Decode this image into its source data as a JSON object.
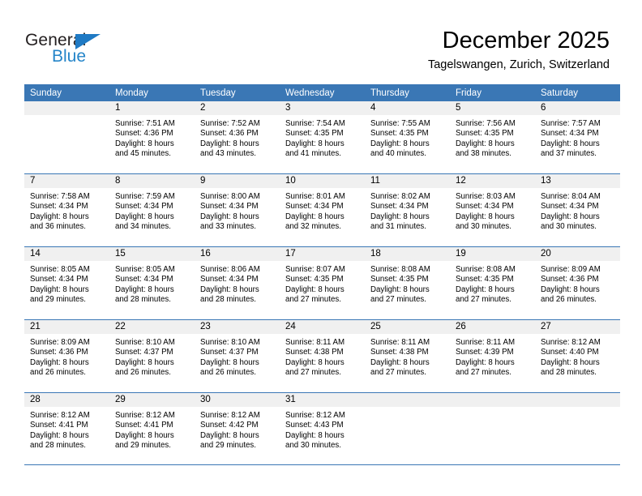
{
  "logo": {
    "top_text": "General",
    "bottom_text": "Blue",
    "triangle_icon": "blue-triangle-icon",
    "brand_blue": "#2585c9"
  },
  "header": {
    "month_title": "December 2025",
    "location": "Tagelswangen, Zurich, Switzerland"
  },
  "theme": {
    "header_blue": "#3a77b5",
    "daynum_band_gray": "#f0f0f0",
    "text_black": "#000000"
  },
  "weekday_headers": [
    "Sunday",
    "Monday",
    "Tuesday",
    "Wednesday",
    "Thursday",
    "Friday",
    "Saturday"
  ],
  "weeks": [
    [
      {
        "day": "",
        "sunrise": "",
        "sunset": "",
        "daylight_line1": "",
        "daylight_line2": "",
        "empty": true
      },
      {
        "day": "1",
        "sunrise": "Sunrise: 7:51 AM",
        "sunset": "Sunset: 4:36 PM",
        "daylight_line1": "Daylight: 8 hours",
        "daylight_line2": "and 45 minutes."
      },
      {
        "day": "2",
        "sunrise": "Sunrise: 7:52 AM",
        "sunset": "Sunset: 4:36 PM",
        "daylight_line1": "Daylight: 8 hours",
        "daylight_line2": "and 43 minutes."
      },
      {
        "day": "3",
        "sunrise": "Sunrise: 7:54 AM",
        "sunset": "Sunset: 4:35 PM",
        "daylight_line1": "Daylight: 8 hours",
        "daylight_line2": "and 41 minutes."
      },
      {
        "day": "4",
        "sunrise": "Sunrise: 7:55 AM",
        "sunset": "Sunset: 4:35 PM",
        "daylight_line1": "Daylight: 8 hours",
        "daylight_line2": "and 40 minutes."
      },
      {
        "day": "5",
        "sunrise": "Sunrise: 7:56 AM",
        "sunset": "Sunset: 4:35 PM",
        "daylight_line1": "Daylight: 8 hours",
        "daylight_line2": "and 38 minutes."
      },
      {
        "day": "6",
        "sunrise": "Sunrise: 7:57 AM",
        "sunset": "Sunset: 4:34 PM",
        "daylight_line1": "Daylight: 8 hours",
        "daylight_line2": "and 37 minutes."
      }
    ],
    [
      {
        "day": "7",
        "sunrise": "Sunrise: 7:58 AM",
        "sunset": "Sunset: 4:34 PM",
        "daylight_line1": "Daylight: 8 hours",
        "daylight_line2": "and 36 minutes."
      },
      {
        "day": "8",
        "sunrise": "Sunrise: 7:59 AM",
        "sunset": "Sunset: 4:34 PM",
        "daylight_line1": "Daylight: 8 hours",
        "daylight_line2": "and 34 minutes."
      },
      {
        "day": "9",
        "sunrise": "Sunrise: 8:00 AM",
        "sunset": "Sunset: 4:34 PM",
        "daylight_line1": "Daylight: 8 hours",
        "daylight_line2": "and 33 minutes."
      },
      {
        "day": "10",
        "sunrise": "Sunrise: 8:01 AM",
        "sunset": "Sunset: 4:34 PM",
        "daylight_line1": "Daylight: 8 hours",
        "daylight_line2": "and 32 minutes."
      },
      {
        "day": "11",
        "sunrise": "Sunrise: 8:02 AM",
        "sunset": "Sunset: 4:34 PM",
        "daylight_line1": "Daylight: 8 hours",
        "daylight_line2": "and 31 minutes."
      },
      {
        "day": "12",
        "sunrise": "Sunrise: 8:03 AM",
        "sunset": "Sunset: 4:34 PM",
        "daylight_line1": "Daylight: 8 hours",
        "daylight_line2": "and 30 minutes."
      },
      {
        "day": "13",
        "sunrise": "Sunrise: 8:04 AM",
        "sunset": "Sunset: 4:34 PM",
        "daylight_line1": "Daylight: 8 hours",
        "daylight_line2": "and 30 minutes."
      }
    ],
    [
      {
        "day": "14",
        "sunrise": "Sunrise: 8:05 AM",
        "sunset": "Sunset: 4:34 PM",
        "daylight_line1": "Daylight: 8 hours",
        "daylight_line2": "and 29 minutes."
      },
      {
        "day": "15",
        "sunrise": "Sunrise: 8:05 AM",
        "sunset": "Sunset: 4:34 PM",
        "daylight_line1": "Daylight: 8 hours",
        "daylight_line2": "and 28 minutes."
      },
      {
        "day": "16",
        "sunrise": "Sunrise: 8:06 AM",
        "sunset": "Sunset: 4:34 PM",
        "daylight_line1": "Daylight: 8 hours",
        "daylight_line2": "and 28 minutes."
      },
      {
        "day": "17",
        "sunrise": "Sunrise: 8:07 AM",
        "sunset": "Sunset: 4:35 PM",
        "daylight_line1": "Daylight: 8 hours",
        "daylight_line2": "and 27 minutes."
      },
      {
        "day": "18",
        "sunrise": "Sunrise: 8:08 AM",
        "sunset": "Sunset: 4:35 PM",
        "daylight_line1": "Daylight: 8 hours",
        "daylight_line2": "and 27 minutes."
      },
      {
        "day": "19",
        "sunrise": "Sunrise: 8:08 AM",
        "sunset": "Sunset: 4:35 PM",
        "daylight_line1": "Daylight: 8 hours",
        "daylight_line2": "and 27 minutes."
      },
      {
        "day": "20",
        "sunrise": "Sunrise: 8:09 AM",
        "sunset": "Sunset: 4:36 PM",
        "daylight_line1": "Daylight: 8 hours",
        "daylight_line2": "and 26 minutes."
      }
    ],
    [
      {
        "day": "21",
        "sunrise": "Sunrise: 8:09 AM",
        "sunset": "Sunset: 4:36 PM",
        "daylight_line1": "Daylight: 8 hours",
        "daylight_line2": "and 26 minutes."
      },
      {
        "day": "22",
        "sunrise": "Sunrise: 8:10 AM",
        "sunset": "Sunset: 4:37 PM",
        "daylight_line1": "Daylight: 8 hours",
        "daylight_line2": "and 26 minutes."
      },
      {
        "day": "23",
        "sunrise": "Sunrise: 8:10 AM",
        "sunset": "Sunset: 4:37 PM",
        "daylight_line1": "Daylight: 8 hours",
        "daylight_line2": "and 26 minutes."
      },
      {
        "day": "24",
        "sunrise": "Sunrise: 8:11 AM",
        "sunset": "Sunset: 4:38 PM",
        "daylight_line1": "Daylight: 8 hours",
        "daylight_line2": "and 27 minutes."
      },
      {
        "day": "25",
        "sunrise": "Sunrise: 8:11 AM",
        "sunset": "Sunset: 4:38 PM",
        "daylight_line1": "Daylight: 8 hours",
        "daylight_line2": "and 27 minutes."
      },
      {
        "day": "26",
        "sunrise": "Sunrise: 8:11 AM",
        "sunset": "Sunset: 4:39 PM",
        "daylight_line1": "Daylight: 8 hours",
        "daylight_line2": "and 27 minutes."
      },
      {
        "day": "27",
        "sunrise": "Sunrise: 8:12 AM",
        "sunset": "Sunset: 4:40 PM",
        "daylight_line1": "Daylight: 8 hours",
        "daylight_line2": "and 28 minutes."
      }
    ],
    [
      {
        "day": "28",
        "sunrise": "Sunrise: 8:12 AM",
        "sunset": "Sunset: 4:41 PM",
        "daylight_line1": "Daylight: 8 hours",
        "daylight_line2": "and 28 minutes."
      },
      {
        "day": "29",
        "sunrise": "Sunrise: 8:12 AM",
        "sunset": "Sunset: 4:41 PM",
        "daylight_line1": "Daylight: 8 hours",
        "daylight_line2": "and 29 minutes."
      },
      {
        "day": "30",
        "sunrise": "Sunrise: 8:12 AM",
        "sunset": "Sunset: 4:42 PM",
        "daylight_line1": "Daylight: 8 hours",
        "daylight_line2": "and 29 minutes."
      },
      {
        "day": "31",
        "sunrise": "Sunrise: 8:12 AM",
        "sunset": "Sunset: 4:43 PM",
        "daylight_line1": "Daylight: 8 hours",
        "daylight_line2": "and 30 minutes."
      },
      {
        "day": "",
        "sunrise": "",
        "sunset": "",
        "daylight_line1": "",
        "daylight_line2": "",
        "empty": true
      },
      {
        "day": "",
        "sunrise": "",
        "sunset": "",
        "daylight_line1": "",
        "daylight_line2": "",
        "empty": true
      },
      {
        "day": "",
        "sunrise": "",
        "sunset": "",
        "daylight_line1": "",
        "daylight_line2": "",
        "empty": true
      }
    ]
  ]
}
